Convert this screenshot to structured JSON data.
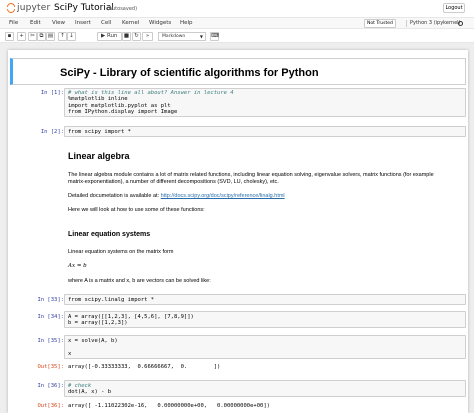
{
  "app": {
    "brand": "jupyter",
    "notebook_title": "SciPy Tutorial",
    "save_status": "(autosaved)",
    "logout": "Logout"
  },
  "menu": [
    "File",
    "Edit",
    "View",
    "Insert",
    "Cell",
    "Kernel",
    "Widgets",
    "Help"
  ],
  "status": {
    "trust": "Not Trusted",
    "kernel": "Python 3 (ipykernel)"
  },
  "toolbar": {
    "run_label": "Run",
    "cell_type": "Markdown"
  },
  "colors": {
    "accent": "#f37726",
    "selected_border": "#42a5f5",
    "in_prompt": "#303f9f",
    "out_prompt": "#d84315"
  },
  "cells": {
    "title": "SciPy - Library of scientific algorithms for Python",
    "in1": {
      "prompt": "In [1]:",
      "lines": [
        "# what is this line all about? Answer in lecture 4",
        "%matplotlib inline",
        "import matplotlib.pyplot as plt",
        "from IPython.display import Image"
      ]
    },
    "in2": {
      "prompt": "In [2]:",
      "code": "from scipy import *"
    },
    "linalg_heading": "Linear algebra",
    "linalg_p1": "The linear algebra module contains a lot of matrix related functions, including linear equation solving, eigenvalue solvers, matrix functions (for example",
    "linalg_p1b": "matrix-exponentiation), a number of different decompositions (SVD, LU, cholesky), etc.",
    "doc_prefix": "Detailed documetation is available at: ",
    "doc_link": "http://docs.scipy.org/doc/scipy/reference/linalg.html",
    "linalg_p3": "Here we will look at how to use some of these functions:",
    "lin_eq_heading": "Linear equation systems",
    "lin_eq_p1": "Linear equation systems on the matrix form",
    "lin_eq_math": "Ax = b",
    "lin_eq_p2": "where A is a matrix and x, b are vectors can be solved like:",
    "in33": {
      "prompt": "In [33]:",
      "code": "from scipy.linalg import *"
    },
    "in34": {
      "prompt": "In [34]:",
      "lines": [
        "A = array([[1,2,3], [4,5,6], [7,8,9]])",
        "b = array([1,2,3])"
      ]
    },
    "in35": {
      "prompt": "In [35]:",
      "lines": [
        "x = solve(A, b)",
        "",
        "x"
      ]
    },
    "out35": {
      "prompt": "Out[35]:",
      "text": "array([-0.33333333,  0.66666667,  0.        ])"
    },
    "in36": {
      "prompt": "In [36]:",
      "lines": [
        "# check",
        "dot(A, x) - b"
      ]
    },
    "out36": {
      "prompt": "Out[36]:",
      "text": "array([ -1.11022302e-16,   0.00000000e+00,   0.00000000e+00])"
    }
  }
}
